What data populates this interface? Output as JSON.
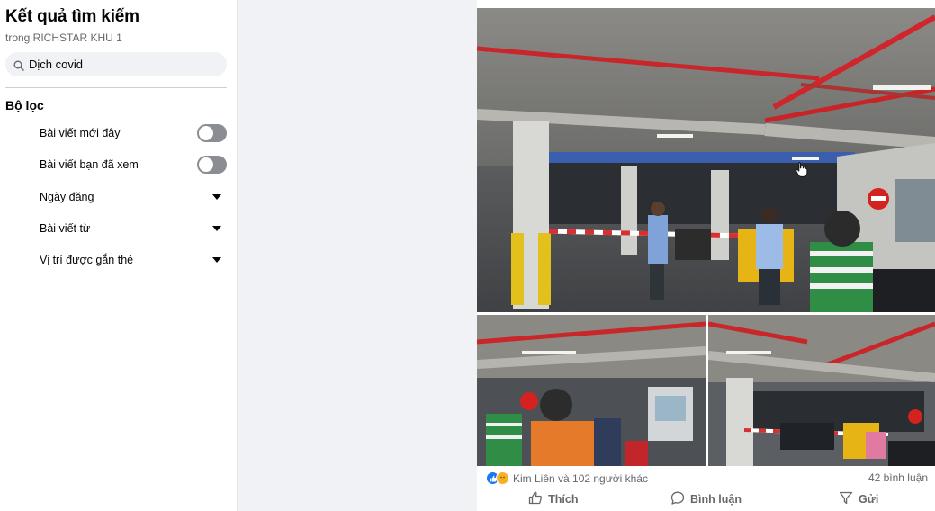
{
  "search_panel": {
    "title": "Kết quả tìm kiếm",
    "subtitle": "trong RICHSTAR KHU 1",
    "search_value": "Dịch covid",
    "filters_title": "Bộ lọc",
    "filters": [
      {
        "label": "Bài viết mới đây",
        "control": "toggle",
        "on": false
      },
      {
        "label": "Bài viết bạn đã xem",
        "control": "toggle",
        "on": false
      },
      {
        "label": "Ngày đăng",
        "control": "dropdown"
      },
      {
        "label": "Bài viết từ",
        "control": "dropdown"
      },
      {
        "label": "Vị trí được gắn thẻ",
        "control": "dropdown"
      }
    ]
  },
  "post": {
    "reactions_text": "Kim Liên và 102 người khác",
    "reaction_icons": [
      "like-icon",
      "sad-icon"
    ],
    "comments_text": "42 bình luận",
    "actions": [
      {
        "label": "Thích",
        "icon": "thumbs-up-icon"
      },
      {
        "label": "Bình luận",
        "icon": "comment-icon"
      },
      {
        "label": "Gửi",
        "icon": "send-icon"
      }
    ]
  },
  "colors": {
    "accent": "#1877f2",
    "toggle_off": "#8a8d91",
    "secondary_text": "#65676b",
    "page_bg": "#f0f2f5"
  }
}
